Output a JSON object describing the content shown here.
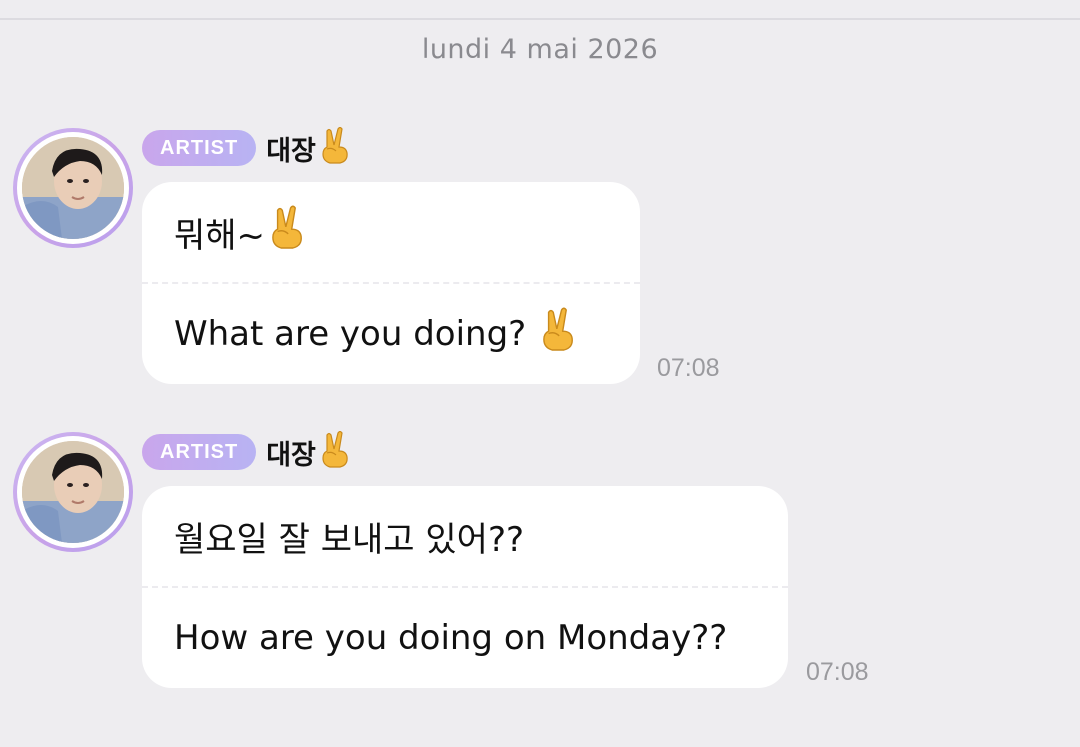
{
  "date_separator": "lundi 4 mai 2026",
  "messages": [
    {
      "badge": "ARTIST",
      "sender": "대장",
      "original_text": "뭐해~",
      "translated_text": "What are you doing?",
      "time": "07:08"
    },
    {
      "badge": "ARTIST",
      "sender": "대장",
      "original_text": "월요일 잘 보내고 있어??",
      "translated_text": "How are you doing on Monday??",
      "time": "07:08"
    }
  ],
  "icons": {
    "victory": "victory-hand-emoji",
    "avatar": "artist-avatar"
  },
  "colors": {
    "background": "#eeedf0",
    "bubble": "#ffffff",
    "badge_start": "#c9a6ec",
    "badge_end": "#b8b3f3",
    "timestamp": "#9a9a9e"
  }
}
